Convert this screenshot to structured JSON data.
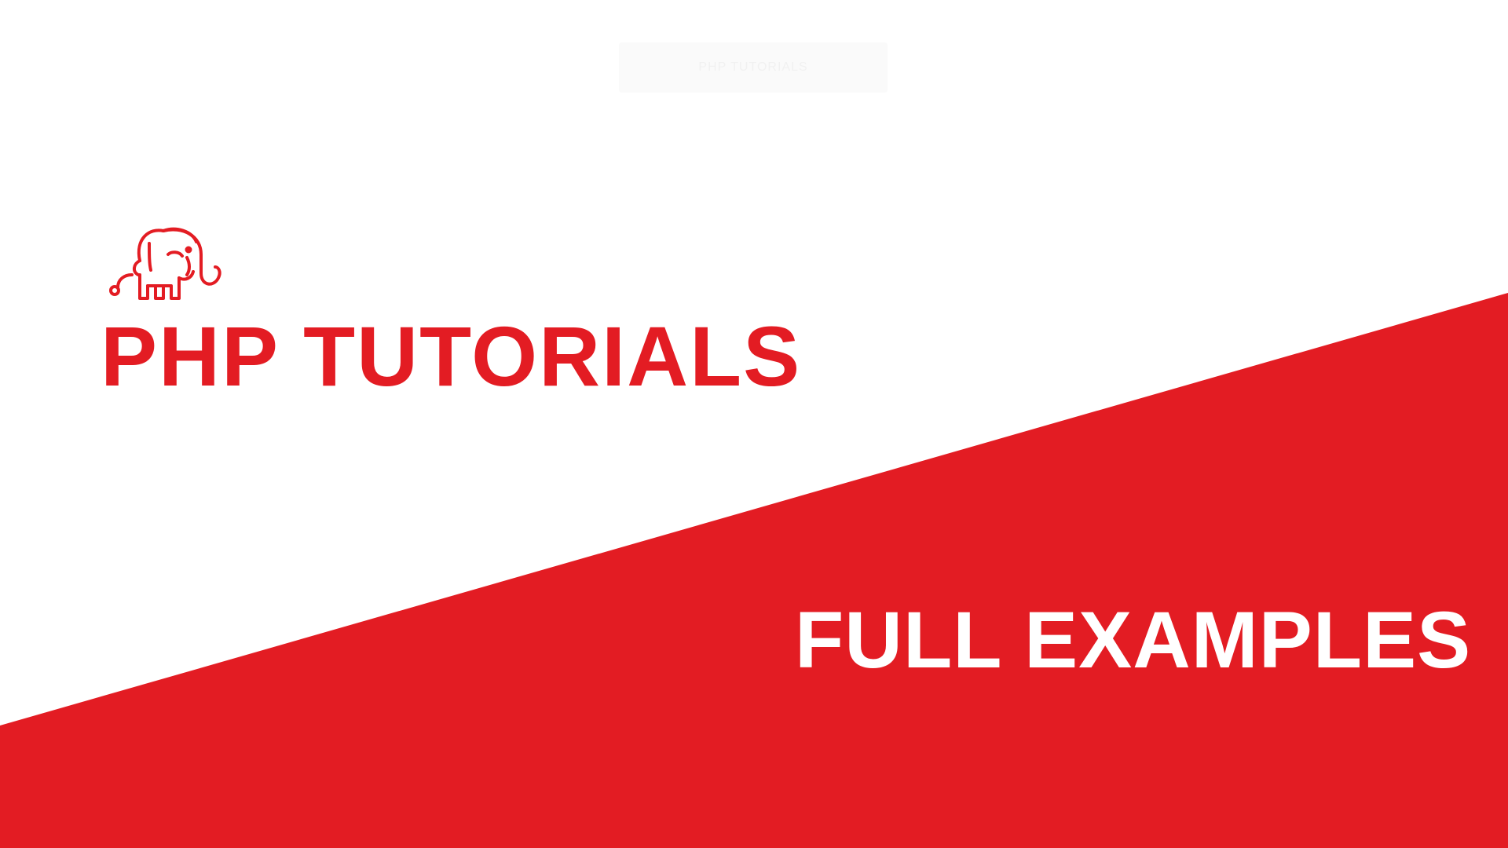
{
  "badge": {
    "text": "PHP TUTORIALS"
  },
  "logo": {
    "icon": "elephant-icon"
  },
  "headline": "PHP TUTORIALS",
  "subline": "FULL EXAMPLES",
  "colors": {
    "brand_red": "#e31c23",
    "background": "#ffffff",
    "subline_text": "#ffffff"
  }
}
